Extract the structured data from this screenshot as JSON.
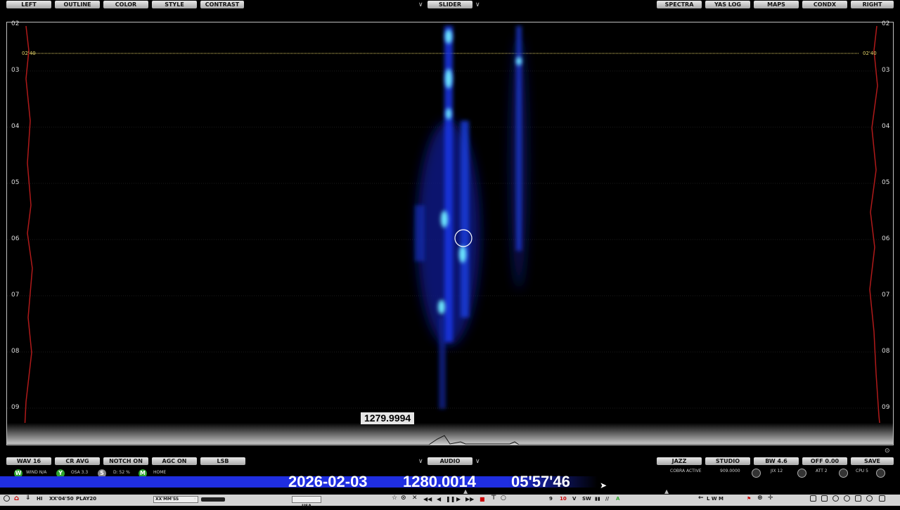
{
  "top_left_buttons": [
    "LEFT",
    "OUTLINE",
    "COLOR",
    "STYLE",
    "CONTRAST"
  ],
  "top_center_button": "SLIDER",
  "top_right_buttons": [
    "SPECTRA",
    "YAS LOG",
    "MAPS",
    "CONDX",
    "RIGHT"
  ],
  "time_labels": [
    "02",
    "03",
    "04",
    "05",
    "06",
    "07",
    "08",
    "09"
  ],
  "marker_label": "02'40",
  "freq_tag": "1279.9994",
  "bottom_left_buttons": [
    "WAV 16",
    "CR AVG",
    "NOTCH ON",
    "AGC ON",
    "LSB"
  ],
  "bottom_center_button": "AUDIO",
  "bottom_right_buttons": [
    "JAZZ",
    "STUDIO",
    "BW 4.6",
    "OFF 0.00",
    "SAVE"
  ],
  "status": {
    "w_text": "WIND N/A",
    "y_text": "OSA 3.3",
    "s_text": "D: 52 %",
    "m_text": "HOME",
    "w_letter": "W",
    "y_letter": "Y",
    "s_letter": "S",
    "m_letter": "M"
  },
  "readout": {
    "date": "2026-02-03",
    "frequency": "1280.0014",
    "time": "05'57'46"
  },
  "right_status": {
    "cobra": "COBRA ACTIVE",
    "value": "909.0000",
    "jix": "JIX 12",
    "att": "ATT 2",
    "cpu": "CPU 5"
  },
  "bottom_bar": {
    "hi": "HI",
    "clock": "XX'04'50",
    "play": "PLAY20",
    "format": "XX'MM'SS",
    "country": "USA",
    "lwm": "L W M"
  },
  "colors": {
    "accent_blue": "#1f2ee0",
    "button_gray": "#c8c8c8",
    "marker_yellow": "#e8d66a",
    "trace_red": "#b01a1a",
    "w_green": "#2fa52f",
    "s_gray": "#888888"
  }
}
